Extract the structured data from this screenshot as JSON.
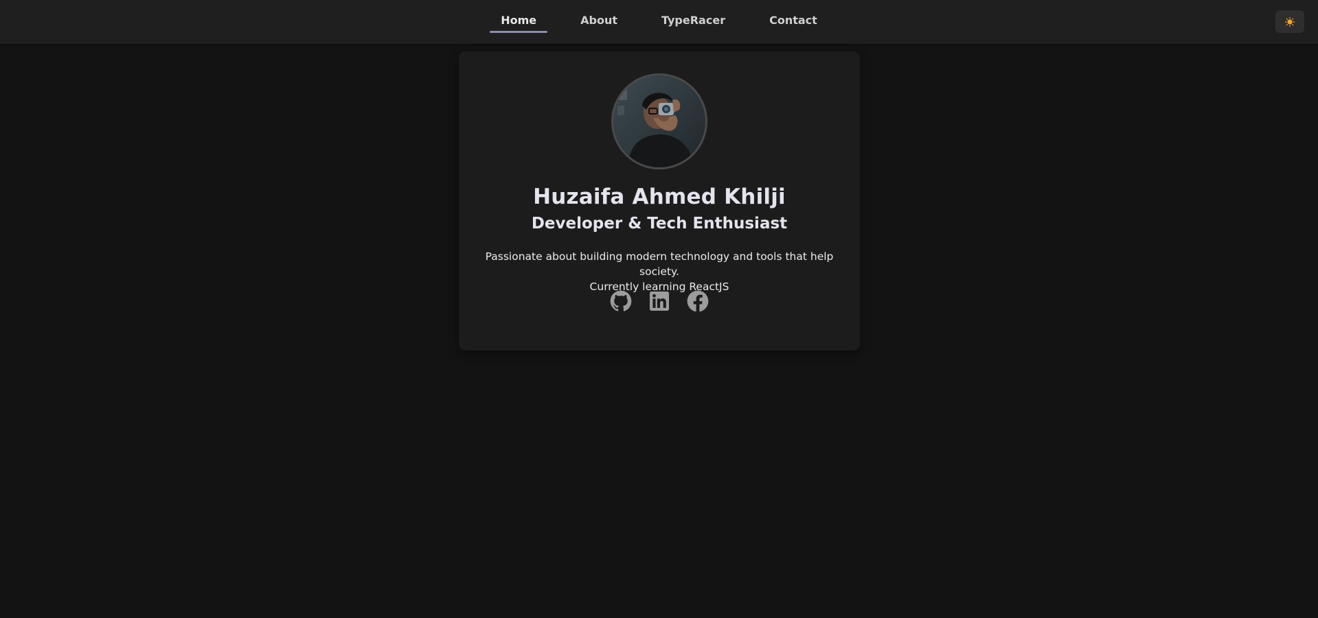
{
  "nav": {
    "links": [
      {
        "label": "Home",
        "active": true
      },
      {
        "label": "About"
      },
      {
        "label": "TypeRacer"
      },
      {
        "label": "Contact"
      }
    ],
    "theme_toggle_icon": "sun-icon"
  },
  "profile": {
    "avatar_icon": "profile-photo",
    "name": "Huzaifa Ahmed Khilji",
    "title": "Developer & Tech Enthusiast",
    "bio_line1": "Passionate about building modern technology and tools that help society.",
    "bio_line2": "Currently learning ReactJS",
    "socials": [
      {
        "icon": "github-icon"
      },
      {
        "icon": "linkedin-icon"
      },
      {
        "icon": "facebook-icon"
      }
    ]
  },
  "colors": {
    "background": "#131313",
    "navbar": "#1f1f1f",
    "card": "#1c1c1c",
    "accent_underline": "#8a8fb0",
    "icon_gray": "#9c9c9c",
    "sun": "#f5a623"
  }
}
